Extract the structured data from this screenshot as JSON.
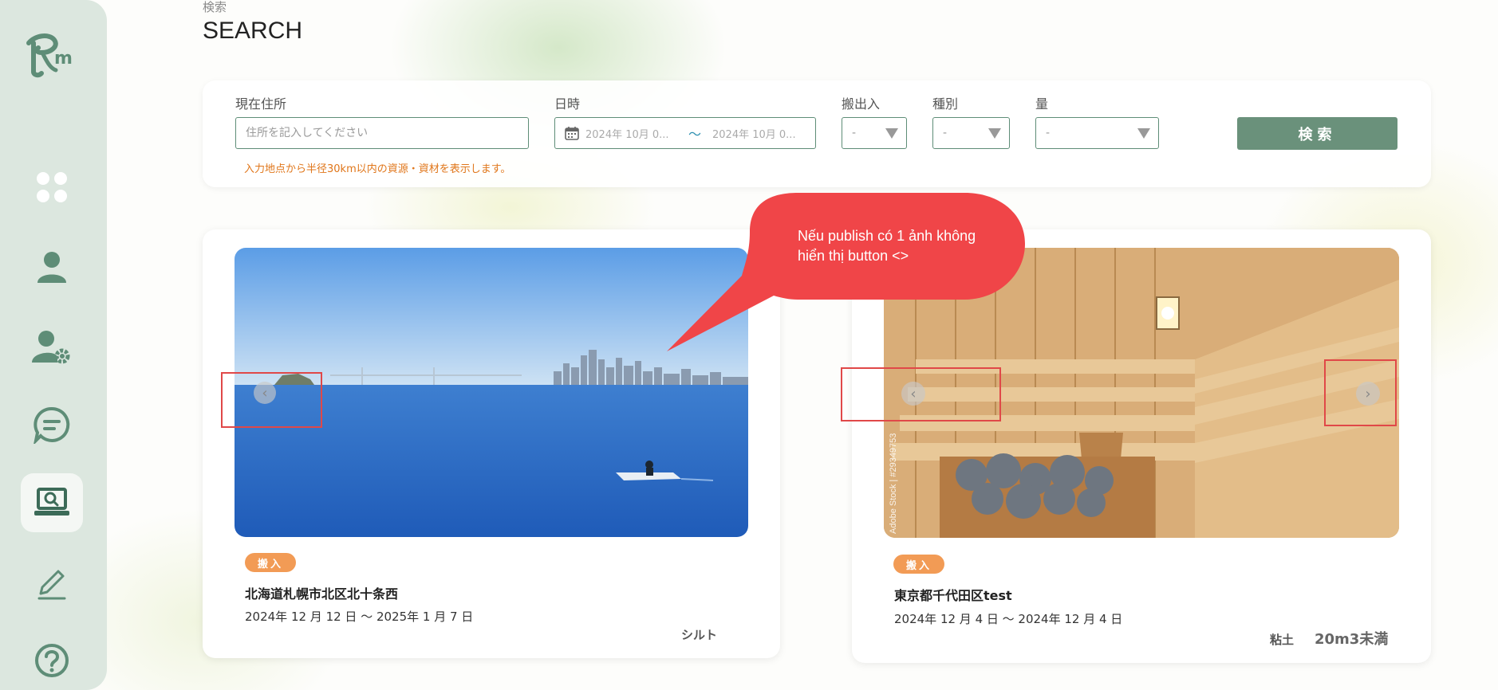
{
  "app": {
    "logo_text": "Rm"
  },
  "sidebar": {
    "items": [
      {
        "name": "dashboard",
        "icon": "grid-icon"
      },
      {
        "name": "profile",
        "icon": "user-icon"
      },
      {
        "name": "user-settings",
        "icon": "user-gear-icon"
      },
      {
        "name": "chat",
        "icon": "chat-icon"
      },
      {
        "name": "search",
        "icon": "laptop-search-icon",
        "active": true
      },
      {
        "name": "edit",
        "icon": "pen-icon"
      },
      {
        "name": "help",
        "icon": "help-icon"
      }
    ]
  },
  "page": {
    "subtitle": "検索",
    "title": "SEARCH"
  },
  "search": {
    "address_label": "現在住所",
    "address_placeholder": "住所を記入してください",
    "address_hint": "入力地点から半径30km以内の資源・資材を表示します。",
    "date_label": "日時",
    "date_from": "2024年 10月 0...",
    "date_sep": "〜",
    "date_to": "2024年 10月 0...",
    "inout_label": "搬出入",
    "inout_value": "-",
    "kind_label": "種別",
    "kind_value": "-",
    "qty_label": "量",
    "qty_value": "-",
    "button_label": "検索"
  },
  "cards": [
    {
      "tag": "搬入",
      "title": "北海道札幌市北区北十条西",
      "date": "2024年 12 月 12 日 〜 2025年 1 月 7 日",
      "kind": "シルト",
      "qty": ""
    },
    {
      "tag": "搬入",
      "title": "東京都千代田区test",
      "date": "2024年 12 月 4 日 〜 2024年 12 月 4 日",
      "kind": "粘土",
      "qty": "20m3未満",
      "watermark": "Adobe Stock | #29349753"
    }
  ],
  "annotation": {
    "text": "Nếu publish có 1 ảnh không hiển thị button <>"
  },
  "colors": {
    "accent": "#6a917b",
    "tag": "#f29b55",
    "hint": "#e0761a",
    "callout": "#f04548"
  }
}
